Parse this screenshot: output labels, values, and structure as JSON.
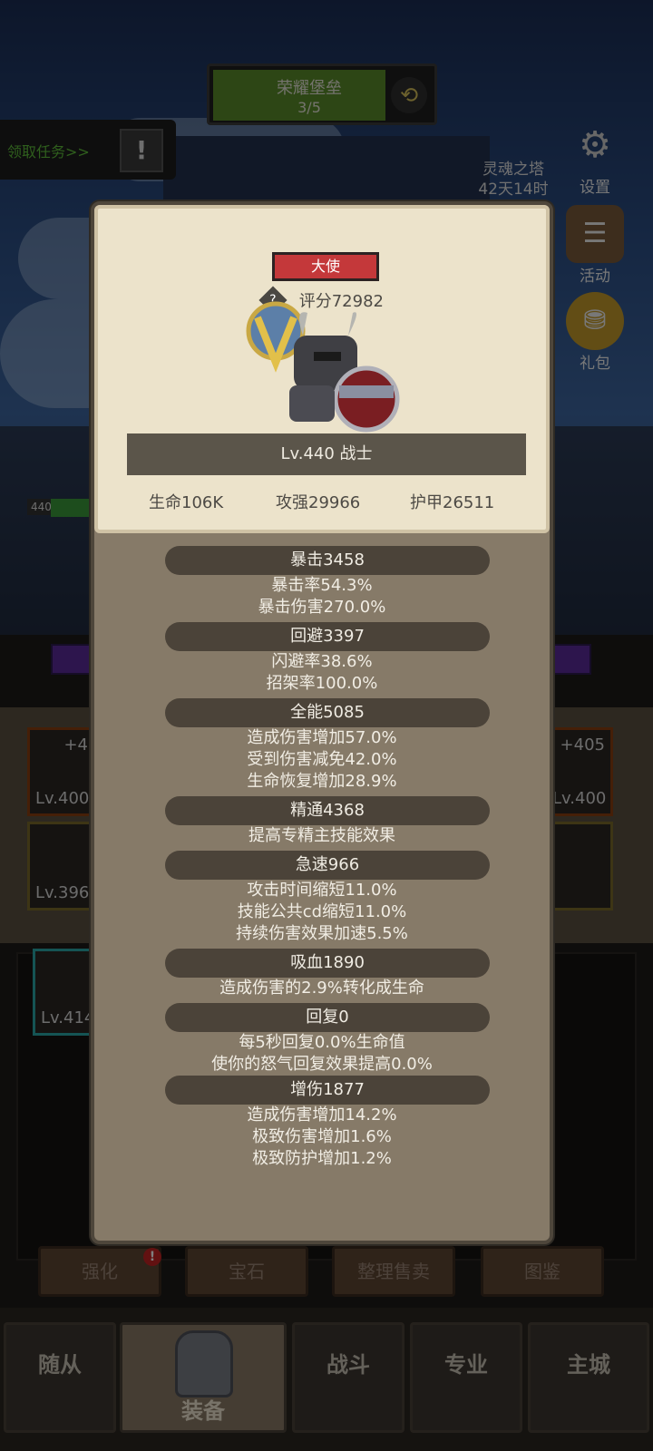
{
  "top_banner": {
    "title": "荣耀堡垒",
    "progress": "3/5",
    "progress_fraction": 0.75
  },
  "quest": {
    "label": "领取任务>>",
    "icon": "exclamation-icon"
  },
  "side_menu": {
    "tower": {
      "name": "灵魂之塔",
      "time": "42天14时"
    },
    "settings": "设置",
    "activity": "活动",
    "gift": "礼包"
  },
  "hero_hp": {
    "level_tag": "440"
  },
  "equip_slots": {
    "left_top": {
      "plus": "+4",
      "lv": "Lv.400"
    },
    "left_mid": {
      "lv": "Lv.396"
    },
    "right_top": {
      "plus": "+405",
      "lv": "Lv.400"
    },
    "bag_item": {
      "lv": "Lv.414"
    }
  },
  "actions": {
    "enhance": "强化",
    "gem": "宝石",
    "sort_sell": "整理售卖",
    "codex": "图鉴",
    "enhance_badge": "!"
  },
  "nav": {
    "follower": "随从",
    "equipment": "装备",
    "battle": "战斗",
    "profession": "专业",
    "main_city": "主城"
  },
  "modal": {
    "title_badge": "大使",
    "score": "评分72982",
    "level_class": "Lv.440 战士",
    "hp": "生命106K",
    "attack": "攻强29966",
    "armor": "护甲26511",
    "sections": [
      {
        "header": "暴击3458",
        "lines": [
          "暴击率54.3%",
          "暴击伤害270.0%"
        ]
      },
      {
        "header": "回避3397",
        "lines": [
          "闪避率38.6%",
          "招架率100.0%"
        ]
      },
      {
        "header": "全能5085",
        "lines": [
          "造成伤害增加57.0%",
          "受到伤害减免42.0%",
          "生命恢复增加28.9%"
        ]
      },
      {
        "header": "精通4368",
        "lines": [
          "提高专精主技能效果"
        ]
      },
      {
        "header": "急速966",
        "lines": [
          "攻击时间缩短11.0%",
          "技能公共cd缩短11.0%",
          "持续伤害效果加速5.5%"
        ]
      },
      {
        "header": "吸血1890",
        "lines": [
          "造成伤害的2.9%转化成生命"
        ]
      },
      {
        "header": "回复0",
        "lines": [
          "每5秒回复0.0%生命值",
          "使你的怒气回复效果提高0.0%"
        ]
      },
      {
        "header": "增伤1877",
        "lines": [
          "造成伤害增加14.2%",
          "极致伤害增加1.6%",
          "极致防护增加1.2%"
        ]
      }
    ]
  }
}
